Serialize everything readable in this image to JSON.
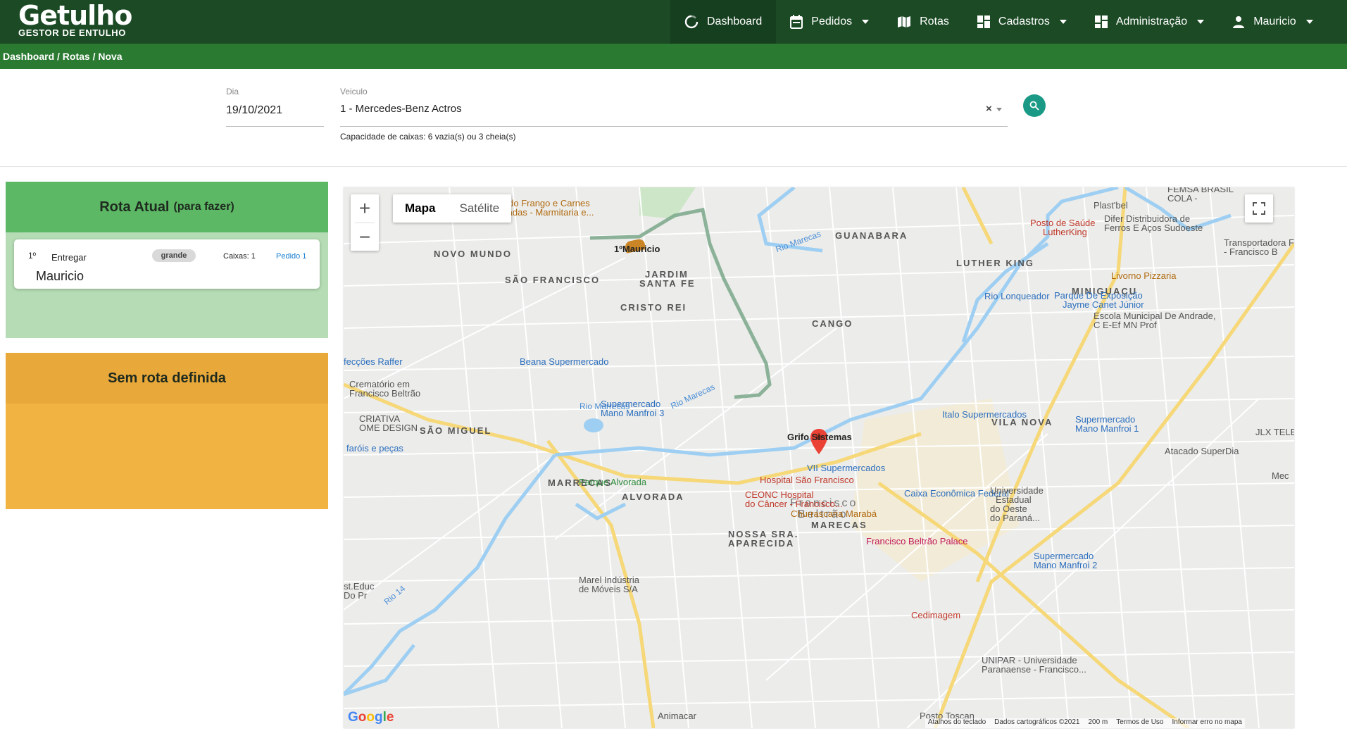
{
  "header": {
    "logo_title": "Getulho",
    "logo_subtitle": "GESTOR DE ENTULHO",
    "nav": [
      {
        "label": "Dashboard",
        "icon": "refresh-icon",
        "dropdown": false
      },
      {
        "label": "Pedidos",
        "icon": "calendar-icon",
        "dropdown": true
      },
      {
        "label": "Rotas",
        "icon": "map-icon",
        "dropdown": false
      },
      {
        "label": "Cadastros",
        "icon": "dashboard-grid-icon",
        "dropdown": true
      },
      {
        "label": "Administração",
        "icon": "dashboard-grid-icon",
        "dropdown": true
      },
      {
        "label": "Mauricio",
        "icon": "user-icon",
        "dropdown": true
      }
    ]
  },
  "breadcrumb": "Dashboard / Rotas / Nova",
  "form": {
    "dia_label": "Dia",
    "dia_value": "19/10/2021",
    "veiculo_label": "Veiculo",
    "veiculo_value": "1 - Mercedes-Benz Actros",
    "clear": "×",
    "capacity": "Capacidade de caixas: 6 vazia(s) ou 3 cheia(s)"
  },
  "rota_atual": {
    "title": "Rota Atual",
    "subtitle": "(para fazer)",
    "color_head": "#5db866",
    "color_body": "#b5dcb4",
    "stops": [
      {
        "order": "1º",
        "action": "Entregar",
        "size": "grande",
        "boxes": "Caixas: 1",
        "link": "Pedido 1",
        "name": "Mauricio"
      }
    ]
  },
  "sem_rota": {
    "title": "Sem rota definida",
    "color_head": "#e9a93a",
    "color_body": "#f1b443"
  },
  "map": {
    "type_options": [
      "Mapa",
      "Satélite"
    ],
    "selected_type": "Mapa",
    "zoom_in": "+",
    "zoom_out": "−",
    "logo": "Google",
    "attribution": [
      "Atalhos do teclado",
      "Dados cartográficos ©2021",
      "200 m",
      "Termos de Uso",
      "Informar erro no mapa"
    ],
    "route_marker": "1ºMauricio",
    "origin_marker": "Grifo Sistemas",
    "neighborhoods": [
      "NOVO MUNDO",
      "SÃO FRANCISCO",
      "JARDIM",
      "SANTA FE",
      "CRISTO REI",
      "GUANABARA",
      "LUTHER KING",
      "MINIGUAÇU",
      "CANGO",
      "SÃO MIGUEL",
      "MARRECAS",
      "ALVORADA",
      "NOSSA SRA.",
      "APARECIDA",
      "MARECAS",
      "VILA NOVA"
    ],
    "city": [
      "Francisco",
      "Beltrão"
    ],
    "pois": [
      "Rei do Frango e Carnes",
      "Assadas - Marmitaria e...",
      "Posto de Saúde",
      "LutherKing",
      "Plast'bel",
      "FEMSA BRASIL",
      "COLA -",
      "Difer Distribuidora de",
      "Ferros E Aços Sudoeste",
      "Transportadora F",
      "- Francisco B",
      "Livorno Pizzaria",
      "Parque De Exposição",
      "Jayme Canet Júnior",
      "Escola Municipal De Andrade,",
      "C E-Ef MN Prof",
      "Rio Lonqueador",
      "Italo Supermercados",
      "Supermercado",
      "Mano Manfroi 1",
      "JLX TELE",
      "Atacado SuperDia",
      "Mec",
      "fecções Raffer",
      "Beana Supermercado",
      "Crematório em",
      "Francisco Beltrão",
      "CRIATIVA",
      "OME DESIGN",
      "faróis e peças",
      "Supermercado",
      "Mano Manfroi 3",
      "VII Supermercados",
      "Hospital São Francisco",
      "CEONC Hospital",
      "do Câncer - Francisco...",
      "Churrascaria Marabá",
      "Caixa Econômica Federal",
      "Universidade",
      "Estadual",
      "do Oeste",
      "do Paraná...",
      "Francisco Beltrão Palace",
      "Supermercado",
      "Mano Manfroi 2",
      "Parque Alvorada",
      "Marel Indústria",
      "de Móveis S/A",
      "st.Educ",
      "Do Pr",
      "Cedimagem",
      "UNIPAR - Universidade",
      "Paranaense - Francisco...",
      "Animacar",
      "Posto Toscan"
    ],
    "rivers": [
      "Rio Marecas",
      "Rio Marrecas",
      "Rio Marecas",
      "Rio 14"
    ]
  }
}
